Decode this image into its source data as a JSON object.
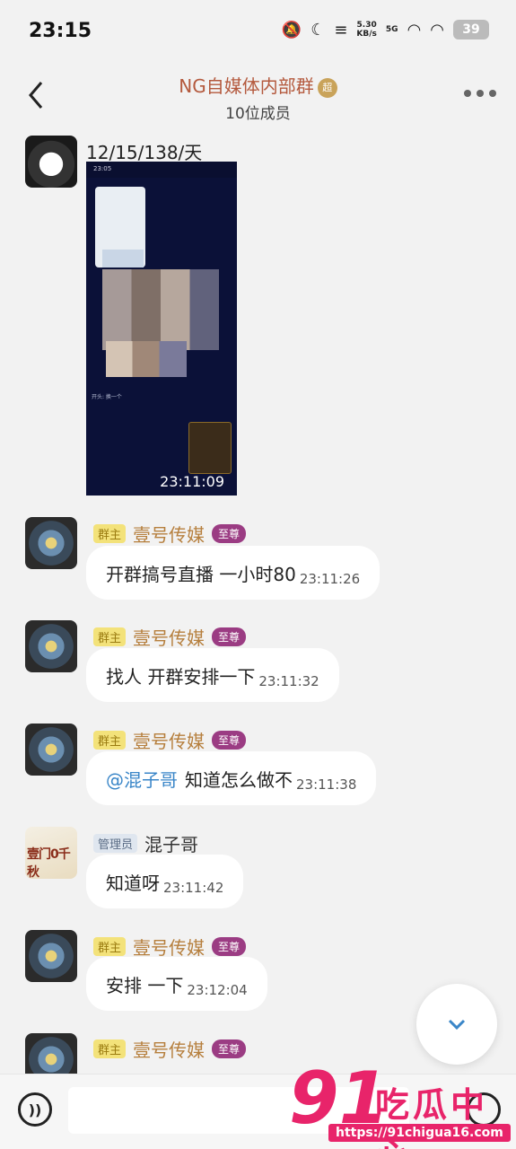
{
  "status_bar": {
    "time": "23:15",
    "net_speed_value": "5.30",
    "net_speed_unit": "KB/s",
    "network": "5G",
    "battery": "39"
  },
  "header": {
    "title": "NG自媒体内部群",
    "title_badge": "超",
    "subtitle": "10位成员"
  },
  "messages": [
    {
      "sender": "12/15/138/天",
      "type": "image",
      "image_timestamp": "23:11:09",
      "image_desc_label": "开头: 换一个"
    },
    {
      "role": "群主",
      "sender": "壹号传媒",
      "rank": "至尊",
      "text": "开群搞号直播   一小时80",
      "time": "23:11:26"
    },
    {
      "role": "群主",
      "sender": "壹号传媒",
      "rank": "至尊",
      "text": "找人 开群安排一下",
      "time": "23:11:32"
    },
    {
      "role": "群主",
      "sender": "壹号传媒",
      "rank": "至尊",
      "mention": "@混子哥",
      "text": "知道怎么做不",
      "time": "23:11:38"
    },
    {
      "role": "管理员",
      "sender": "混子哥",
      "avatar_text": "壹门0千秋",
      "text": "知道呀",
      "time": "23:11:42"
    },
    {
      "role": "群主",
      "sender": "壹号传媒",
      "rank": "至尊",
      "text": "安排 一下",
      "time": "23:12:04"
    },
    {
      "role": "群主",
      "sender": "壹号传媒",
      "rank": "至尊"
    }
  ],
  "input": {
    "voice_label": "))",
    "placeholder": ""
  },
  "watermark": {
    "number": "91",
    "brand": "吃瓜中心",
    "url": "https://91chigua16.com"
  },
  "colors": {
    "owner_badge": "#f3e27a",
    "rank_badge": "#9b3c83",
    "mention": "#3a86c8",
    "title": "#b4593d",
    "watermark": "#e8246a"
  }
}
